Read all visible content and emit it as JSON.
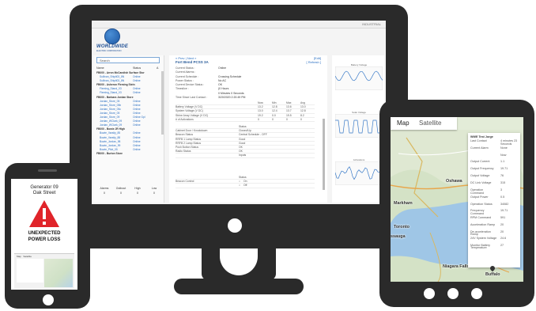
{
  "monitor": {
    "topbar_user": "INDUSTRIAL",
    "logo": {
      "name": "WORLDWIDE",
      "sub": "ELECTRIC CORPORATION"
    },
    "search": {
      "placeholder": "Search"
    },
    "sidebar": {
      "headers": {
        "name": "Name",
        "status": "Status",
        "sort": "A"
      },
      "rows": [
        {
          "type": "group",
          "name": "FB000 - Arron McCandish Surface Stor"
        },
        {
          "type": "item",
          "name": "Sullivan_Shipli03_8N",
          "status": "Online"
        },
        {
          "type": "item",
          "name": "Sullivan_Shipli03_8N",
          "status": "Online"
        },
        {
          "type": "group",
          "name": "FB000 - Asheron Fleming Stein"
        },
        {
          "type": "item",
          "name": "Fleming_Stand_03",
          "status": "Online"
        },
        {
          "type": "item",
          "name": "Fleming_Stand_03",
          "status": "Online"
        },
        {
          "type": "group",
          "name": "FB000 - Barbara Jordan Store"
        },
        {
          "type": "item",
          "name": "Jordan_Store_05",
          "status": "Online"
        },
        {
          "type": "item",
          "name": "Jordan_Store_05b",
          "status": "Online"
        },
        {
          "type": "item",
          "name": "Jordan_Store_05c",
          "status": "Online"
        },
        {
          "type": "item",
          "name": "Jordan_Store_05",
          "status": "Online"
        },
        {
          "type": "item",
          "name": "Jordan_Store_09",
          "status": "Online Gpl"
        },
        {
          "type": "item",
          "name": "Jordan_WClark_09",
          "status": "Online"
        },
        {
          "type": "item",
          "name": "Jordan_WClark_09",
          "status": "Online"
        },
        {
          "type": "group",
          "name": "FB000 - Bowie JR High"
        },
        {
          "type": "item",
          "name": "Bowie_Varsity_85",
          "status": "Online"
        },
        {
          "type": "item",
          "name": "Bowie_Varsity_88",
          "status": "Online"
        },
        {
          "type": "item",
          "name": "Bowie_Jordan_98",
          "status": "Online"
        },
        {
          "type": "item",
          "name": "Bowie_Jordan_99",
          "status": "Online"
        },
        {
          "type": "item",
          "name": "Bowie_Pilot_05",
          "status": "Online"
        },
        {
          "type": "group",
          "name": "FB000 - Burton Store"
        }
      ],
      "footer": [
        {
          "label": "Alarms",
          "value": "0"
        },
        {
          "label": "Outbout",
          "value": "0"
        },
        {
          "label": "High",
          "value": "0"
        },
        {
          "label": "Low",
          "value": "0"
        }
      ]
    },
    "detail": {
      "nav": "« Prev | Next »",
      "site": "Fort Bend PCSS 3A",
      "edit": "[Edit]",
      "refresh": "[ Refresh ]",
      "status_rows": [
        {
          "k": "Current Status :",
          "v": "Online"
        },
        {
          "k": "Current Alarms :",
          "v": ""
        },
        {
          "k": "Current Schedule :",
          "v": "Crossing Schedule"
        },
        {
          "k": "Power Status :",
          "v": "No AC"
        },
        {
          "k": "Current Device Status :",
          "v": "OK"
        },
        {
          "k": "Timeslice :",
          "v": "(0 Hours"
        },
        {
          "k": "",
          "v": "0 Minutes 0 Seconds"
        },
        {
          "k": "Time Since Last Contact :",
          "v": "3/20/2020 2:20:49 PM"
        }
      ],
      "volt_headers": [
        "",
        "Now",
        "Min",
        "Max",
        "Avg"
      ],
      "volt_rows": [
        {
          "k": "Battery Voltage (V DC)",
          "c": [
            "13.2",
            "12.8",
            "13.6",
            "13.0"
          ]
        },
        {
          "k": "System Voltage (V DC)",
          "c": [
            "13.0",
            "12.4",
            "13.7",
            "12.8"
          ]
        },
        {
          "k": "Strine Array Voltage (V DC)",
          "c": [
            "19.2",
            "0.0",
            "19.5",
            "8.2"
          ]
        },
        {
          "k": "# of Activations",
          "c": [
            "0",
            "0",
            "0",
            "0"
          ]
        }
      ],
      "cab_header": "Status",
      "cab_rows": [
        {
          "k": "Cabinet Door / Knockdown",
          "v": "Closed/Up"
        },
        {
          "k": "Beacon Status",
          "v": "Central Schedule - OFF"
        },
        {
          "k": "RRFB 1 Lamp Status",
          "v": "Good"
        },
        {
          "k": "RRFB 2 Lamp Status",
          "v": "Good"
        },
        {
          "k": "Push Button Status",
          "v": "OK"
        },
        {
          "k": "Radio Status",
          "v": "OK"
        }
      ],
      "inputs_label": "Inputs",
      "ctrl_header": "Status",
      "ctrl_rows": [
        {
          "k": "Beacon Control",
          "v": "On"
        },
        {
          "k": "",
          "v": "Off"
        }
      ]
    },
    "charts": [
      {
        "title": "Battery Voltage"
      },
      {
        "title": "Solar Voltage"
      },
      {
        "title": "Activations"
      }
    ]
  },
  "phone": {
    "title_line1": "Generator 09",
    "title_line2": "Oak Street",
    "alert_line1": "UNEXPECTED",
    "alert_line2": "POWER LOSS",
    "mini_map": {
      "tab1": "Map",
      "tab2": "Satellite"
    }
  },
  "tablet": {
    "tabs": {
      "map": "Map",
      "satellite": "Satellite"
    },
    "cities": [
      "Oshawa",
      "Markham",
      "Toronto",
      "ssauga",
      "Niagara Falls",
      "Buffalo",
      "Rochester"
    ],
    "popup": {
      "title": "WWE Test Jorge",
      "rows": [
        {
          "k": "Last Contact",
          "v": "4 minutes 23 Seconds"
        },
        {
          "k": "Current Alarm",
          "v": "None"
        },
        {
          "k": "",
          "v": "Now"
        },
        {
          "k": "Output Current",
          "v": "1.1"
        },
        {
          "k": "Output Frequency",
          "v": "19.71"
        },
        {
          "k": "Output Voltage",
          "v": "76"
        },
        {
          "k": "DC Link Voltage",
          "v": "315"
        },
        {
          "k": "Operation Command",
          "v": "3"
        },
        {
          "k": "Output Power",
          "v": "0.5"
        },
        {
          "k": "Operation Status",
          "v": "34082"
        },
        {
          "k": "Frequency Command",
          "v": "19.71"
        },
        {
          "k": "RPM Command",
          "v": "591"
        },
        {
          "k": "Acceleration Ramp",
          "v": "20"
        },
        {
          "k": "De-acceleration Ramp",
          "v": "20"
        },
        {
          "k": "24V System Voltage",
          "v": "24.6"
        },
        {
          "k": "Monitor Battery Temperature",
          "v": "27"
        }
      ]
    }
  }
}
